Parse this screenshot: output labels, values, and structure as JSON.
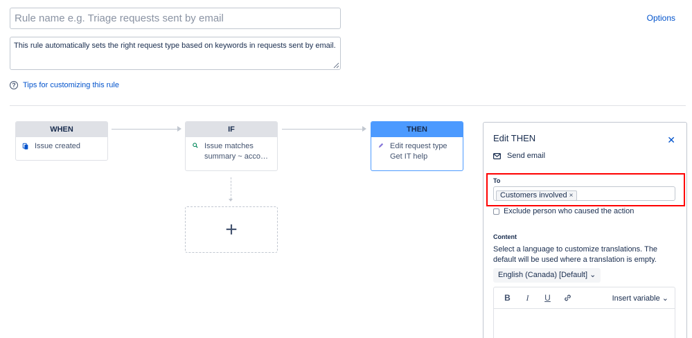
{
  "header": {
    "rule_name_placeholder": "Rule name e.g. Triage requests sent by email",
    "options_label": "Options"
  },
  "description": {
    "text": "This rule automatically sets the right request type based on keywords in requests sent by email."
  },
  "tips": {
    "label": "Tips for customizing this rule"
  },
  "flow": {
    "when": {
      "header": "WHEN",
      "lines": [
        "Issue created"
      ]
    },
    "if": {
      "header": "IF",
      "lines": [
        "Issue matches",
        "summary ~ acco…"
      ]
    },
    "then": {
      "header": "THEN",
      "lines": [
        "Edit request type",
        "Get IT help"
      ]
    },
    "add_symbol": "+"
  },
  "panel": {
    "title": "Edit THEN",
    "action_label": "Send email",
    "to_label": "To",
    "to_chips": [
      "Customers involved"
    ],
    "exclude_label": "Exclude person who caused the action",
    "content_label": "Content",
    "content_help": "Select a language to customize translations. The default will be used where a translation is empty.",
    "language_selected": "English (Canada) [Default]",
    "toolbar": {
      "bold": "B",
      "italic": "I",
      "underline": "U",
      "insert_variable": "Insert variable"
    }
  },
  "colors": {
    "accent": "#0052cc",
    "then_header": "#4c9aff",
    "highlight": "#ff0000"
  }
}
